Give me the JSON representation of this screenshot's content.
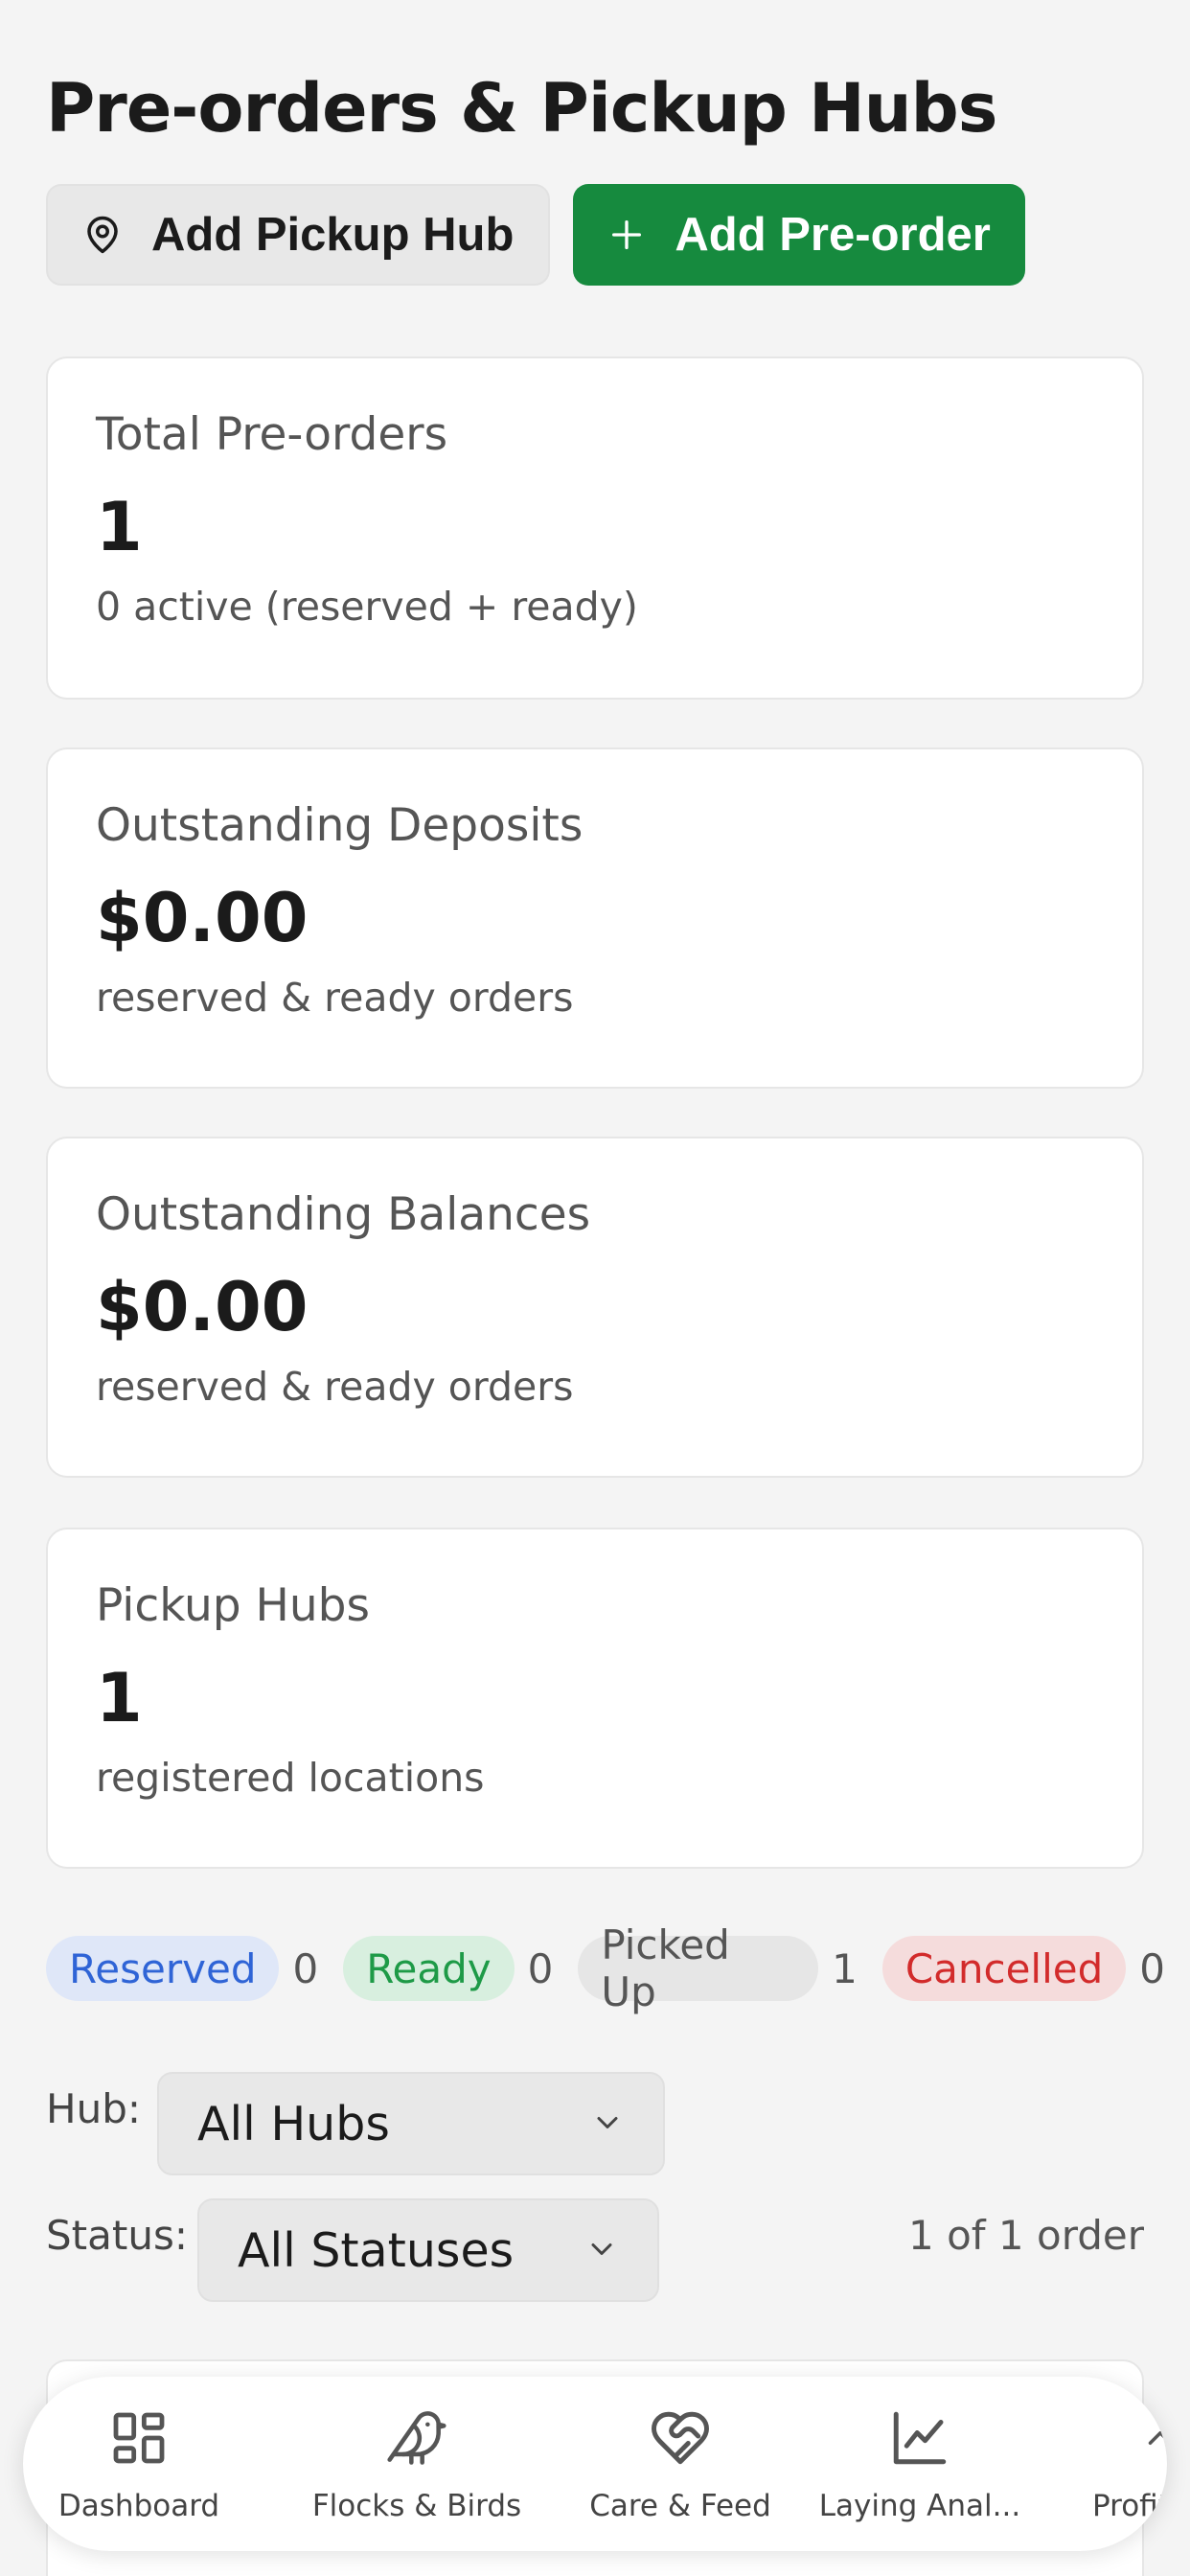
{
  "page": {
    "title": "Pre-orders & Pickup Hubs"
  },
  "actions": {
    "add_hub": "Add Pickup Hub",
    "add_preorder": "Add Pre-order",
    "primary_color": "#168a3e"
  },
  "stats": [
    {
      "label": "Total Pre-orders",
      "value": "1",
      "sub": "0 active (reserved + ready)"
    },
    {
      "label": "Outstanding Deposits",
      "value": "$0.00",
      "sub": "reserved & ready orders"
    },
    {
      "label": "Outstanding Balances",
      "value": "$0.00",
      "sub": "reserved & ready orders"
    },
    {
      "label": "Pickup Hubs",
      "value": "1",
      "sub": "registered locations"
    }
  ],
  "status_chips": [
    {
      "label": "Reserved",
      "count": "0",
      "color": "#2f64d6"
    },
    {
      "label": "Ready",
      "count": "0",
      "color": "#1e9a47"
    },
    {
      "label": "Picked Up",
      "count": "1",
      "color": "#555555"
    },
    {
      "label": "Cancelled",
      "count": "0",
      "color": "#d22b2b"
    }
  ],
  "filters": {
    "hub_label": "Hub:",
    "hub_value": "All Hubs",
    "status_label": "Status:",
    "status_value": "All Statuses",
    "order_count": "1 of 1 order"
  },
  "nav": [
    {
      "label": "Dashboard",
      "icon": "grid-icon"
    },
    {
      "label": "Flocks & Birds",
      "icon": "bird-icon"
    },
    {
      "label": "Care & Feed",
      "icon": "heart-hand-icon"
    },
    {
      "label": "Laying Anal...",
      "icon": "line-chart-icon"
    },
    {
      "label": "Profit ",
      "icon": "chevron-up-icon"
    }
  ]
}
